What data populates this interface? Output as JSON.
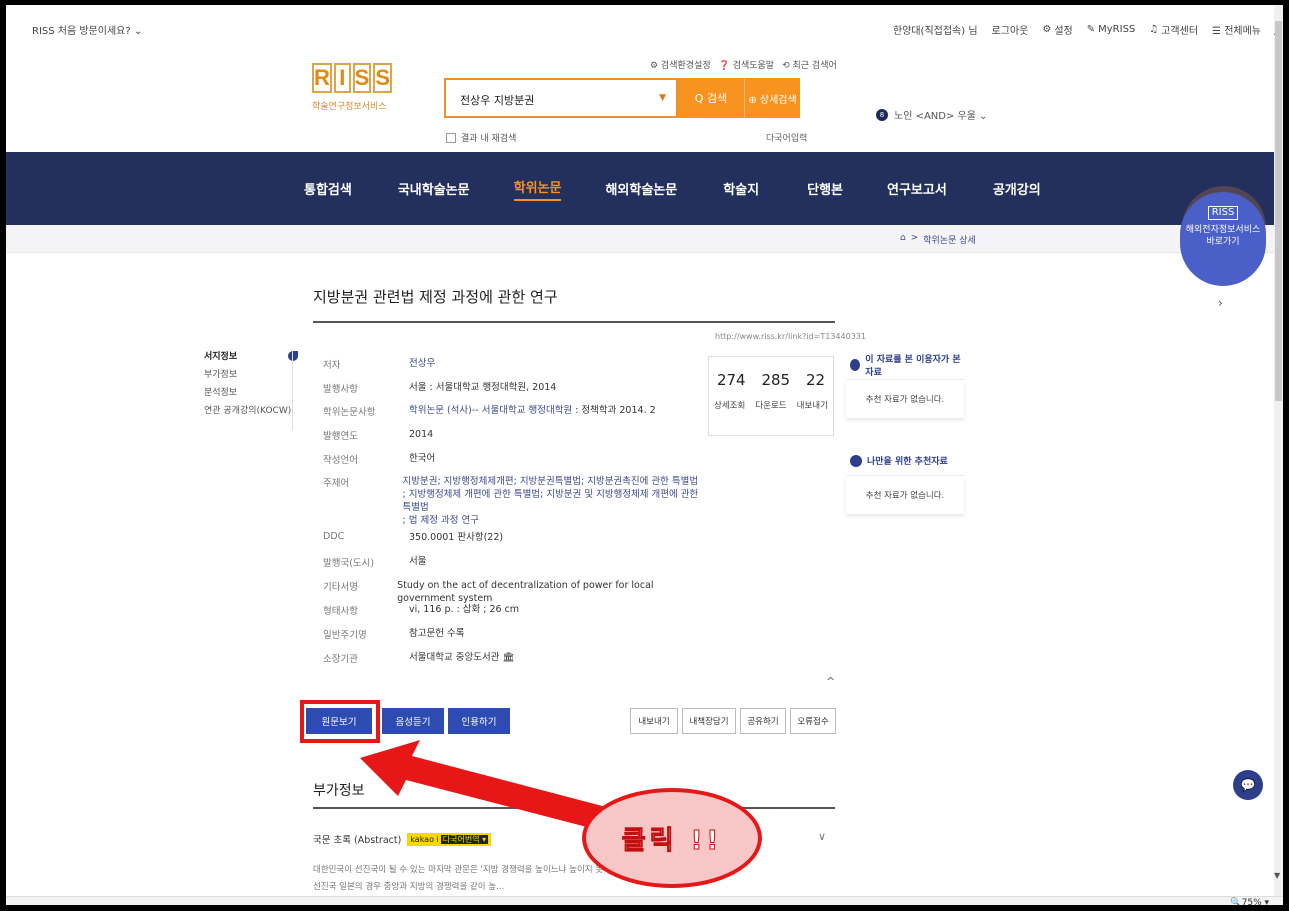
{
  "util": {
    "visit": "RISS 처음 방문이세요?  ⌄",
    "items": [
      "한양대(직접접속) 님",
      "로그아웃",
      "설정",
      "MyRISS",
      "고객센터",
      "☰ 전체메뉴"
    ]
  },
  "logo": {
    "letters": [
      "R",
      "I",
      "S",
      "S"
    ],
    "subtitle": "학술연구정보서비스"
  },
  "toplinks": [
    "⚙ 검색환경설정",
    "❓ 검색도움말",
    "⟲ 최근 검색어"
  ],
  "search": {
    "value": "전상우 지방분권",
    "search_btn": "Q 검색",
    "detail_btn": "⊕ 상세검색",
    "within": "결과 내 재검색",
    "multilang": "다국어입력"
  },
  "keyword": {
    "num": "8",
    "text": "노인 <AND> 우울  ⌄"
  },
  "nav": [
    "통합검색",
    "국내학술논문",
    "학위논문",
    "해외학술논문",
    "학술지",
    "단행본",
    "연구보고서",
    "공개강의"
  ],
  "breadcrumb": {
    "home": "⌂",
    "sep": ">",
    "current": "학위논문 상세"
  },
  "overseas": {
    "logo": "RISS",
    "line1": "해외전자정보서비스",
    "line2": "바로가기"
  },
  "title": "지방분권 관련법 제정 과정에 관한 연구",
  "permalink": "http://www.riss.kr/link?id=T13440331",
  "lefttabs": [
    "서지정보",
    "부가정보",
    "분석정보",
    "연관 공개강의(KOCW)"
  ],
  "meta": {
    "author_k": "저자",
    "author_v": "전상우",
    "pub_k": "발행사항",
    "pub_v": "서울 : 서울대학교 행정대학원, 2014",
    "thesis_k": "학위논문사항",
    "thesis_link": "학위논문 (석사)-- 서울대학교 행정대학원",
    "thesis_rest": " : 정책학과 2014. 2",
    "year_k": "발행연도",
    "year_v": "2014",
    "lang_k": "작성언어",
    "lang_v": "한국어",
    "subj_k": "주제어",
    "subj_l1": "지방분권; 지방행정체제개편; 지방분권특별법; 지방분권촉진에 관한 특별법",
    "subj_l2": "; 지방행정체제 개편에 관한 특별법; 지방분권 및 지방행정체제 개편에 관한 특별법",
    "subj_l3": "; 법 제정 과정 연구",
    "ddc_k": "DDC",
    "ddc_v": "350.0001 판사항(22)",
    "country_k": "발행국(도시)",
    "country_v": "서울",
    "other_k": "기타서명",
    "other_v": "Study on the act of decentralization of power for local government system",
    "form_k": "형태사항",
    "form_v": "vi, 116 p. : 삽화 ; 26 cm",
    "note_k": "일반주기명",
    "note_v": "참고문헌 수록",
    "lib_k": "소장기관",
    "lib_v": "서울대학교 중앙도서관"
  },
  "stats": {
    "views": "274",
    "downloads": "285",
    "exports": "22",
    "l1": "상세조회",
    "l2": "다운로드",
    "l3": "내보내기"
  },
  "rec1": {
    "head": "이 자료를 본 이용자가 본 자료",
    "body": "추천 자료가 없습니다."
  },
  "rec2": {
    "head": "나만을 위한 추천자료",
    "body": "추천 자료가 없습니다."
  },
  "actions": {
    "view": "원문보기",
    "listen": "음성듣기",
    "cite": "인용하기",
    "export": "내보내기",
    "save": "내책장담기",
    "share": "공유하기",
    "report": "오류접수"
  },
  "section2": "부가정보",
  "abstract": {
    "label": "국문 초록 (Abstract)",
    "kakao": "kakao i",
    "translate": "다국어번역 ▾",
    "line1": "대한민국이 선진국이 될 수 있는 마지막 관문은 '지방 경쟁력을 높이느냐 높이지 못하느냐'에",
    "line2": "선진국 일본의 경우 중앙과 지방의 경쟁력을 같이 높..."
  },
  "annotation": {
    "text": "클릭 !!"
  },
  "status": {
    "zoom": "🔍75%   ▾"
  },
  "colors": {
    "nav_bg": "#232f5d",
    "accent": "#f7931e",
    "button_blue": "#2d4bb0",
    "annotation_red": "#e81717"
  }
}
